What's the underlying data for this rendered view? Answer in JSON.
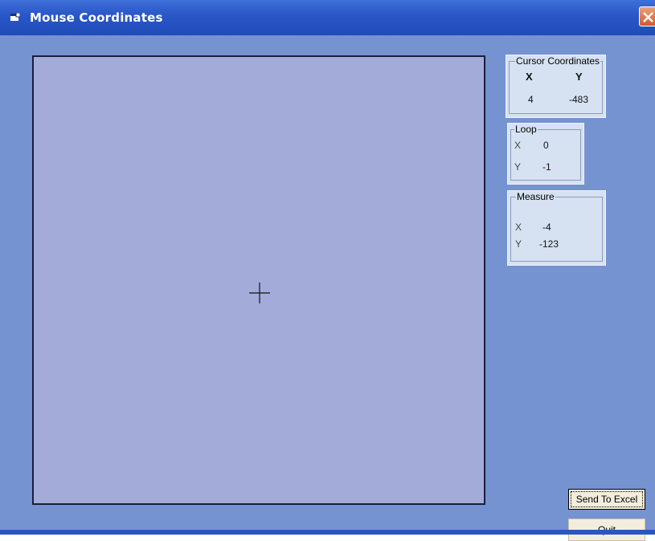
{
  "window": {
    "title": "Mouse Coordinates",
    "icon": "app-window-icon",
    "close_icon": "close-icon",
    "colors": {
      "titlebar": "#2a58c8",
      "client": "#7592d1",
      "canvas": "#a3acd9",
      "panel": "#d6e2f2",
      "close": "#d8562c"
    }
  },
  "cursor_coordinates": {
    "title": "Cursor Coordinates",
    "x_header": "X",
    "y_header": "Y",
    "x_value": "4",
    "y_value": "-483"
  },
  "loop": {
    "title": "Loop",
    "x_label": "X",
    "x_value": "0",
    "y_label": "Y",
    "y_value": "-1"
  },
  "measure": {
    "title": "Measure",
    "x_label": "X",
    "x_value": "-4",
    "y_label": "Y",
    "y_value": "-123"
  },
  "buttons": {
    "send_to_excel": "Send To Excel",
    "quit": "Quit"
  },
  "canvas": {
    "cursor_icon": "crosshair-cursor-icon"
  }
}
